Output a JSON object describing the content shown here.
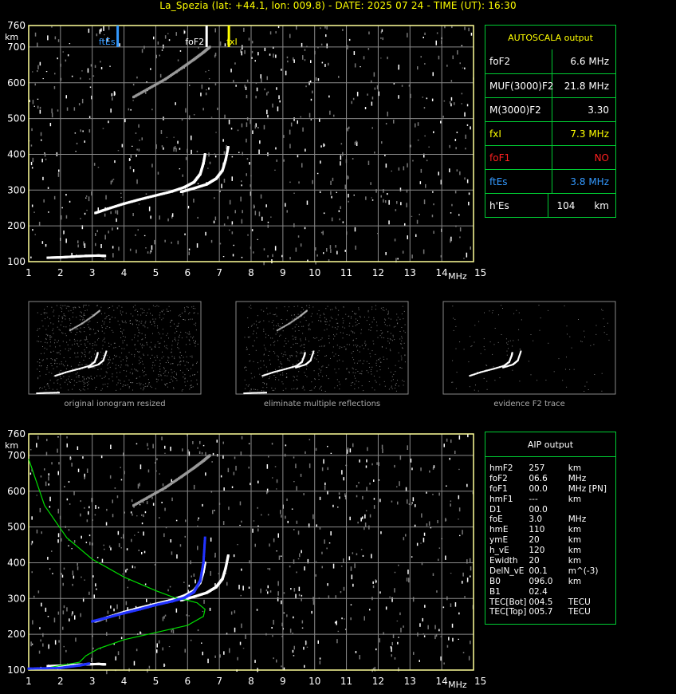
{
  "header": "La_Spezia (lat: +44.1, lon: 009.8) - DATE: 2025 07 24 - TIME (UT): 16:30",
  "colors": {
    "grid": "#8a8a8a",
    "frame": "#ffff99",
    "panel_border": "#00cc33",
    "yellow": "#ffff00",
    "blue": "#3399ff",
    "red": "#ff2020",
    "green": "#33dd33",
    "profile": "#00dd00",
    "trace": "#2233ff"
  },
  "chart_data": [
    {
      "type": "scatter",
      "title": "",
      "xlabel": "MHz",
      "ylabel": "km",
      "xlim": [
        1,
        15
      ],
      "ylim": [
        100,
        760
      ],
      "x_ticks": [
        "1",
        "2",
        "3",
        "4",
        "5",
        "6",
        "7",
        "8",
        "9",
        "10",
        "11",
        "12",
        "13",
        "14",
        "15"
      ],
      "y_ticks": [
        "100",
        "200",
        "300",
        "400",
        "500",
        "600",
        "700",
        "760"
      ],
      "markers": [
        {
          "label": "ftEs",
          "x": 3.8,
          "color": "#3399ff"
        },
        {
          "label": "foF2",
          "x": 6.6,
          "color": "#ffffff"
        },
        {
          "label": "fxI",
          "x": 7.3,
          "color": "#ffff00"
        }
      ],
      "series": [
        {
          "points": [
            [
              1.6,
              111
            ],
            [
              2.0,
              112
            ],
            [
              2.4,
              114
            ],
            [
              2.8,
              116
            ],
            [
              3.2,
              117
            ],
            [
              3.4,
              116
            ]
          ]
        },
        {
          "points": [
            [
              3.1,
              236
            ],
            [
              3.5,
              248
            ],
            [
              4.0,
              262
            ],
            [
              4.5,
              274
            ],
            [
              5.0,
              285
            ],
            [
              5.5,
              296
            ],
            [
              5.9,
              308
            ],
            [
              6.2,
              322
            ],
            [
              6.4,
              345
            ],
            [
              6.5,
              375
            ],
            [
              6.55,
              400
            ]
          ]
        },
        {
          "points": [
            [
              5.8,
              295
            ],
            [
              6.2,
              305
            ],
            [
              6.6,
              316
            ],
            [
              6.9,
              332
            ],
            [
              7.1,
              355
            ],
            [
              7.2,
              385
            ],
            [
              7.28,
              420
            ]
          ]
        },
        {
          "points": [
            [
              4.3,
              560
            ],
            [
              4.8,
              585
            ],
            [
              5.3,
              610
            ],
            [
              5.8,
              640
            ],
            [
              6.2,
              665
            ],
            [
              6.5,
              685
            ],
            [
              6.7,
              700
            ]
          ]
        }
      ]
    },
    {
      "type": "scatter",
      "title": "",
      "xlabel": "MHz",
      "ylabel": "km",
      "xlim": [
        1,
        15
      ],
      "ylim": [
        100,
        760
      ],
      "x_ticks": [
        "1",
        "2",
        "3",
        "4",
        "5",
        "6",
        "7",
        "8",
        "9",
        "10",
        "11",
        "12",
        "13",
        "14",
        "15"
      ],
      "y_ticks": [
        "100",
        "200",
        "300",
        "400",
        "500",
        "600",
        "700",
        "760"
      ],
      "series": [
        {
          "points": [
            [
              1.6,
              111
            ],
            [
              2.0,
              112
            ],
            [
              2.4,
              114
            ],
            [
              2.8,
              116
            ],
            [
              3.2,
              117
            ],
            [
              3.4,
              116
            ]
          ]
        },
        {
          "points": [
            [
              3.1,
              236
            ],
            [
              3.5,
              248
            ],
            [
              4.0,
              262
            ],
            [
              4.5,
              274
            ],
            [
              5.0,
              285
            ],
            [
              5.5,
              296
            ],
            [
              5.9,
              308
            ],
            [
              6.2,
              322
            ],
            [
              6.4,
              345
            ],
            [
              6.5,
              375
            ],
            [
              6.55,
              400
            ]
          ]
        },
        {
          "points": [
            [
              5.8,
              295
            ],
            [
              6.2,
              305
            ],
            [
              6.6,
              316
            ],
            [
              6.9,
              332
            ],
            [
              7.1,
              355
            ],
            [
              7.2,
              385
            ],
            [
              7.28,
              420
            ]
          ]
        },
        {
          "points": [
            [
              4.3,
              560
            ],
            [
              4.8,
              585
            ],
            [
              5.3,
              610
            ],
            [
              5.8,
              640
            ],
            [
              6.2,
              665
            ],
            [
              6.5,
              685
            ],
            [
              6.7,
              700
            ]
          ]
        },
        {
          "points": [
            [
              1.0,
              690
            ],
            [
              1.5,
              560
            ],
            [
              2.2,
              470
            ],
            [
              3.0,
              410
            ],
            [
              4.0,
              360
            ],
            [
              5.0,
              322
            ],
            [
              5.6,
              302
            ],
            [
              6.0,
              295
            ],
            [
              6.3,
              288
            ],
            [
              6.55,
              270
            ],
            [
              6.5,
              250
            ],
            [
              6.0,
              225
            ],
            [
              5.0,
              205
            ],
            [
              4.0,
              185
            ],
            [
              3.2,
              160
            ],
            [
              2.8,
              140
            ],
            [
              2.6,
              122
            ],
            [
              1.5,
              105
            ],
            [
              1.0,
              102
            ]
          ]
        },
        {
          "points": [
            [
              3.0,
              236
            ],
            [
              3.4,
              245
            ],
            [
              4.0,
              259
            ],
            [
              4.5,
              270
            ],
            [
              5.0,
              282
            ],
            [
              5.5,
              292
            ],
            [
              5.9,
              302
            ],
            [
              6.2,
              318
            ],
            [
              6.4,
              350
            ],
            [
              6.5,
              400
            ],
            [
              6.55,
              470
            ]
          ]
        },
        {
          "points": [
            [
              1.0,
              104
            ],
            [
              2.0,
              106
            ],
            [
              2.6,
              113
            ],
            [
              2.9,
              118
            ]
          ]
        }
      ]
    }
  ],
  "autoscala": {
    "title": "AUTOSCALA output",
    "rows": [
      {
        "label": "foF2",
        "value": "6.6 MHz",
        "color": "#ffffff"
      },
      {
        "label": "MUF(3000)F2",
        "value": "21.8 MHz",
        "color": "#ffffff"
      },
      {
        "label": "M(3000)F2",
        "value": "3.30",
        "color": "#ffffff"
      },
      {
        "label": "fxI",
        "value": "7.3 MHz",
        "color": "#ffff00"
      },
      {
        "label": "foF1",
        "value": "NO",
        "color": "#ff2020"
      },
      {
        "label": "ftEs",
        "value": "3.8 MHz",
        "color": "#3399ff"
      },
      {
        "label": "h'Es",
        "value": "104",
        "unit": "km",
        "color": "#ffffff"
      }
    ]
  },
  "thumbnails": [
    {
      "caption": "original ionogram resized"
    },
    {
      "caption": "eliminate multiple reflections"
    },
    {
      "caption": "evidence F2 trace"
    }
  ],
  "aip": {
    "title": "AIP output",
    "rows": [
      {
        "k": "hmF2",
        "v": "257",
        "u": "km"
      },
      {
        "k": "foF2",
        "v": "06.6",
        "u": "MHz"
      },
      {
        "k": "foF1",
        "v": "00.0",
        "u": "MHz   [PN]"
      },
      {
        "k": "hmF1",
        "v": "---",
        "u": "km"
      },
      {
        "k": "D1",
        "v": "00.0",
        "u": ""
      },
      {
        "k": "foE",
        "v": "3.0",
        "u": "MHz"
      },
      {
        "k": "hmE",
        "v": "110",
        "u": "km"
      },
      {
        "k": "ymE",
        "v": "20",
        "u": "km"
      },
      {
        "k": "h_vE",
        "v": "120",
        "u": "km"
      },
      {
        "k": "Ewidth",
        "v": "20",
        "u": "km"
      },
      {
        "k": "DelN_vE",
        "v": "00.1",
        "u": "m^(-3)"
      },
      {
        "k": "B0",
        "v": "096.0",
        "u": "km"
      },
      {
        "k": "B1",
        "v": "02.4",
        "u": ""
      },
      {
        "k": "TEC[Bot]",
        "v": "004.5",
        "u": "TECU"
      },
      {
        "k": "TEC[Top]",
        "v": "005.7",
        "u": "TECU"
      }
    ]
  }
}
